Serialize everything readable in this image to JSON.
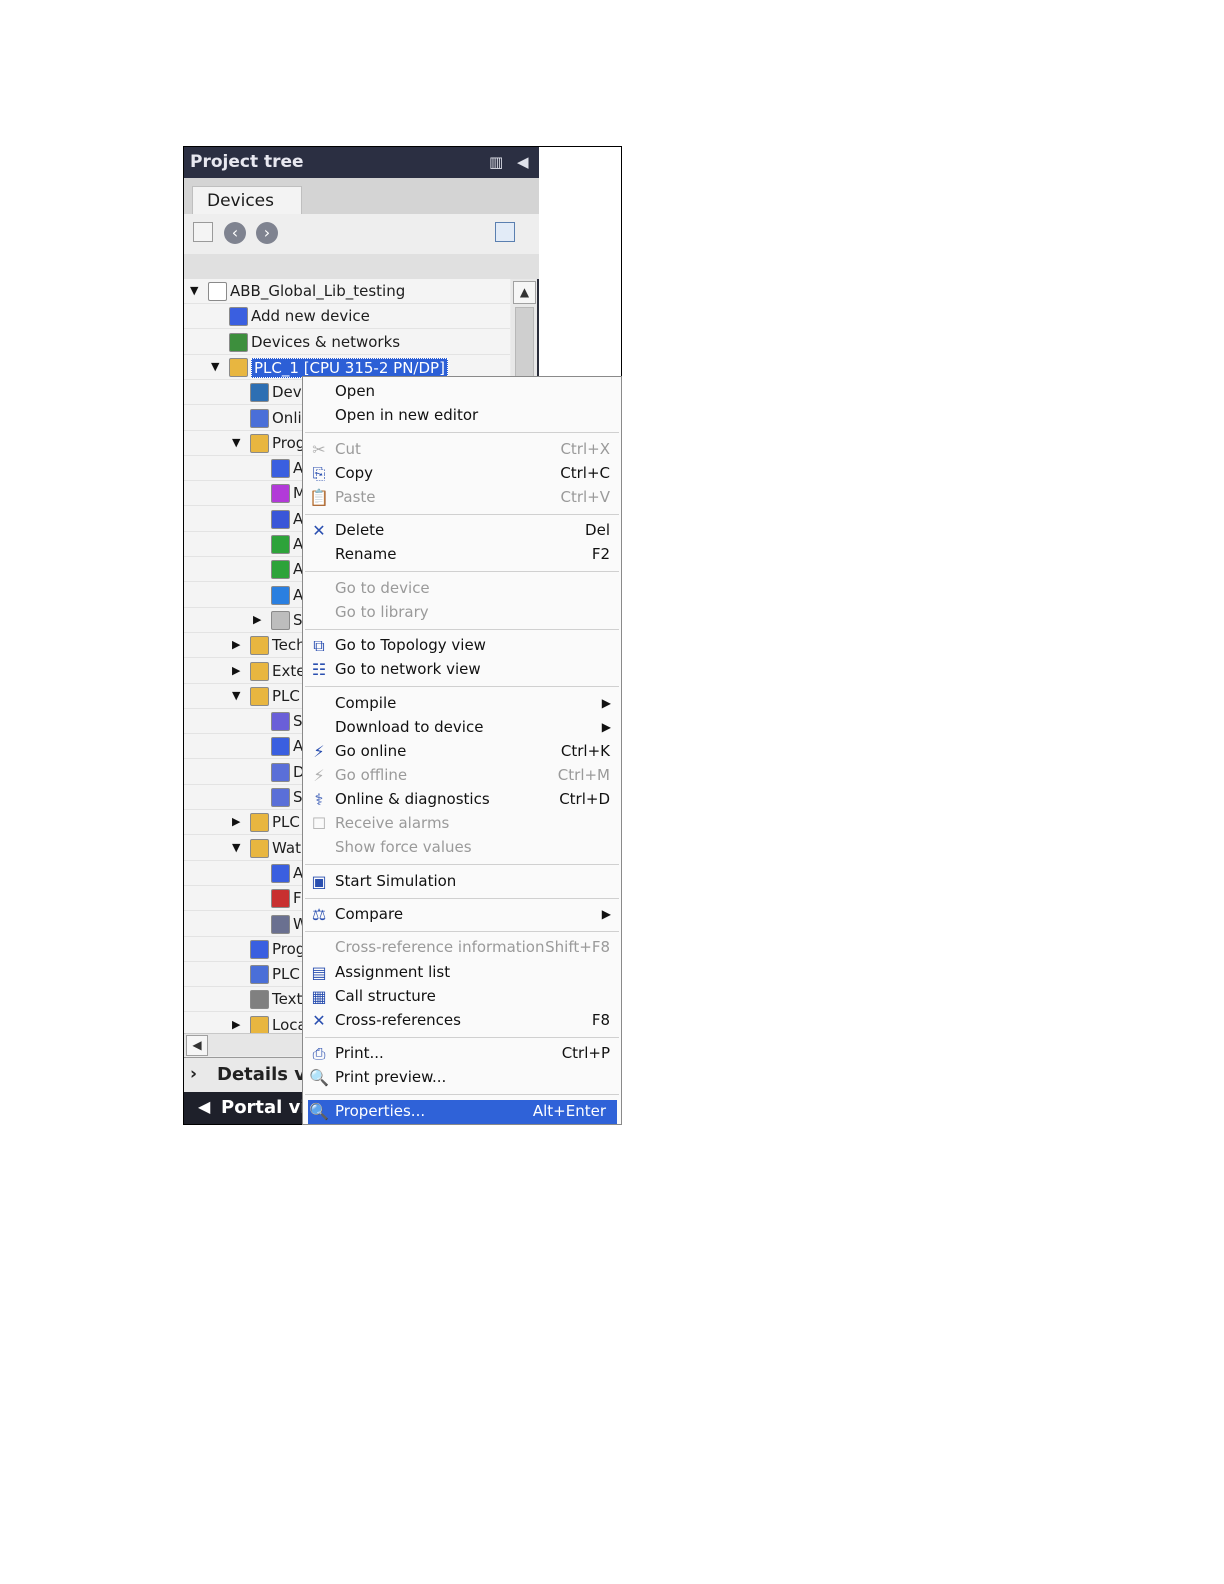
{
  "panel": {
    "title": "Project tree",
    "tab": "Devices",
    "details_label": "Details vi",
    "portal_label": "Portal vie"
  },
  "tree": [
    {
      "label": "ABB_Global_Lib_testing",
      "icon": "project-icon",
      "arrow": "▼",
      "color": "#ffffff"
    },
    {
      "label": "Add new device",
      "icon": "add-device-icon",
      "arrow": "",
      "color": "#3a5fe0"
    },
    {
      "label": "Devices & networks",
      "icon": "network-icon",
      "arrow": "",
      "color": "#3d8f3d"
    },
    {
      "label": "PLC_1 [CPU 315-2 PN/DP]",
      "icon": "plc-folder-icon",
      "arrow": "▼",
      "color": "#e8b640"
    },
    {
      "label": "Dev",
      "icon": "device-config-icon",
      "arrow": "",
      "color": "#2d6fb3"
    },
    {
      "label": "Onli",
      "icon": "online-diagnostics-icon",
      "arrow": "",
      "color": "#4a6fd8"
    },
    {
      "label": "Prog",
      "icon": "program-blocks-folder-icon",
      "arrow": "▼",
      "color": "#e8b640"
    },
    {
      "label": "A",
      "icon": "add-block-icon",
      "arrow": "",
      "color": "#3a5fe0"
    },
    {
      "label": "M",
      "icon": "main-block-icon",
      "arrow": "",
      "color": "#b23ad8"
    },
    {
      "label": "A",
      "icon": "data-block-icon",
      "arrow": "",
      "color": "#3a56d8"
    },
    {
      "label": "A",
      "icon": "function-block-icon",
      "arrow": "",
      "color": "#2da33a"
    },
    {
      "label": "A",
      "icon": "function-block-icon",
      "arrow": "",
      "color": "#2da33a"
    },
    {
      "label": "A",
      "icon": "function-icon",
      "arrow": "",
      "color": "#2a7fe0"
    },
    {
      "label": "S",
      "icon": "system-blocks-icon",
      "arrow": "▶",
      "color": "#bdbdbd"
    },
    {
      "label": "Tech",
      "icon": "technology-objects-icon",
      "arrow": "▶",
      "color": "#e8b640"
    },
    {
      "label": "Exte",
      "icon": "external-sources-icon",
      "arrow": "▶",
      "color": "#e8b640"
    },
    {
      "label": "PLC",
      "icon": "plc-tags-folder-icon",
      "arrow": "▼",
      "color": "#e8b640"
    },
    {
      "label": "S",
      "icon": "show-all-tags-icon",
      "arrow": "",
      "color": "#6a5fd8"
    },
    {
      "label": "A",
      "icon": "add-tag-table-icon",
      "arrow": "",
      "color": "#3a5fe0"
    },
    {
      "label": "D",
      "icon": "default-tag-table-icon",
      "arrow": "",
      "color": "#5a6fd8"
    },
    {
      "label": "S",
      "icon": "tag-table-icon",
      "arrow": "",
      "color": "#5a6fd8"
    },
    {
      "label": "PLC",
      "icon": "plc-data-types-icon",
      "arrow": "▶",
      "color": "#e8b640"
    },
    {
      "label": "Wat",
      "icon": "watch-tables-folder-icon",
      "arrow": "▼",
      "color": "#e8b640"
    },
    {
      "label": "A",
      "icon": "add-watch-table-icon",
      "arrow": "",
      "color": "#3a5fe0"
    },
    {
      "label": "F",
      "icon": "force-table-icon",
      "arrow": "",
      "color": "#c83030"
    },
    {
      "label": "W",
      "icon": "watch-table-icon",
      "arrow": "",
      "color": "#6a7090"
    },
    {
      "label": "Prog",
      "icon": "program-info-icon",
      "arrow": "",
      "color": "#3a5fe0"
    },
    {
      "label": "PLC",
      "icon": "plc-alarms-icon",
      "arrow": "",
      "color": "#4a6fd8"
    },
    {
      "label": "Text",
      "icon": "text-lists-icon",
      "arrow": "",
      "color": "#808080"
    },
    {
      "label": "Loca",
      "icon": "local-modules-folder-icon",
      "arrow": "▶",
      "color": "#e8b640"
    }
  ],
  "menu": [
    {
      "label": "Open",
      "shortcut": "",
      "icon": "",
      "glyph": "",
      "disabled": false,
      "submenu": false,
      "highlight": false
    },
    {
      "label": "Open in new editor",
      "shortcut": "",
      "icon": "",
      "glyph": "",
      "disabled": false,
      "submenu": false,
      "highlight": false,
      "sep_after": true
    },
    {
      "label": "Cut",
      "shortcut": "Ctrl+X",
      "icon": "scissors-icon",
      "glyph": "✂",
      "disabled": true,
      "submenu": false,
      "highlight": false
    },
    {
      "label": "Copy",
      "shortcut": "Ctrl+C",
      "icon": "copy-icon",
      "glyph": "⎘",
      "disabled": false,
      "submenu": false,
      "highlight": false
    },
    {
      "label": "Paste",
      "shortcut": "Ctrl+V",
      "icon": "paste-icon",
      "glyph": "📋",
      "disabled": true,
      "submenu": false,
      "highlight": false,
      "sep_after": true
    },
    {
      "label": "Delete",
      "shortcut": "Del",
      "icon": "delete-icon",
      "glyph": "✕",
      "disabled": false,
      "submenu": false,
      "highlight": false
    },
    {
      "label": "Rename",
      "shortcut": "F2",
      "icon": "",
      "glyph": "",
      "disabled": false,
      "submenu": false,
      "highlight": false,
      "sep_after": true
    },
    {
      "label": "Go to device",
      "shortcut": "",
      "icon": "",
      "glyph": "",
      "disabled": true,
      "submenu": false,
      "highlight": false
    },
    {
      "label": "Go to library",
      "shortcut": "",
      "icon": "",
      "glyph": "",
      "disabled": true,
      "submenu": false,
      "highlight": false,
      "sep_after": true
    },
    {
      "label": "Go to Topology view",
      "shortcut": "",
      "icon": "topology-icon",
      "glyph": "⧉",
      "disabled": false,
      "submenu": false,
      "highlight": false
    },
    {
      "label": "Go to network view",
      "shortcut": "",
      "icon": "network-view-icon",
      "glyph": "☷",
      "disabled": false,
      "submenu": false,
      "highlight": false,
      "sep_after": true
    },
    {
      "label": "Compile",
      "shortcut": "",
      "icon": "",
      "glyph": "",
      "disabled": false,
      "submenu": true,
      "highlight": false
    },
    {
      "label": "Download to device",
      "shortcut": "",
      "icon": "",
      "glyph": "",
      "disabled": false,
      "submenu": true,
      "highlight": false
    },
    {
      "label": "Go online",
      "shortcut": "Ctrl+K",
      "icon": "go-online-icon",
      "glyph": "⚡",
      "disabled": false,
      "submenu": false,
      "highlight": false
    },
    {
      "label": "Go offline",
      "shortcut": "Ctrl+M",
      "icon": "go-offline-icon",
      "glyph": "⚡",
      "disabled": true,
      "submenu": false,
      "highlight": false
    },
    {
      "label": "Online & diagnostics",
      "shortcut": "Ctrl+D",
      "icon": "online-diagnostics-icon",
      "glyph": "⚕",
      "disabled": false,
      "submenu": false,
      "highlight": false
    },
    {
      "label": "Receive alarms",
      "shortcut": "",
      "icon": "checkbox-icon",
      "glyph": "☐",
      "disabled": true,
      "submenu": false,
      "highlight": false
    },
    {
      "label": "Show force values",
      "shortcut": "",
      "icon": "",
      "glyph": "",
      "disabled": true,
      "submenu": false,
      "highlight": false,
      "sep_after": true
    },
    {
      "label": "Start Simulation",
      "shortcut": "",
      "icon": "simulation-icon",
      "glyph": "▣",
      "disabled": false,
      "submenu": false,
      "highlight": false,
      "sep_after": true
    },
    {
      "label": "Compare",
      "shortcut": "",
      "icon": "compare-icon",
      "glyph": "⚖",
      "disabled": false,
      "submenu": true,
      "highlight": false,
      "sep_after": true
    },
    {
      "label": "Cross-reference information",
      "shortcut": "Shift+F8",
      "icon": "",
      "glyph": "",
      "disabled": true,
      "submenu": false,
      "highlight": false
    },
    {
      "label": "Assignment list",
      "shortcut": "",
      "icon": "assignment-list-icon",
      "glyph": "▤",
      "disabled": false,
      "submenu": false,
      "highlight": false
    },
    {
      "label": "Call structure",
      "shortcut": "",
      "icon": "call-structure-icon",
      "glyph": "▦",
      "disabled": false,
      "submenu": false,
      "highlight": false
    },
    {
      "label": "Cross-references",
      "shortcut": "F8",
      "icon": "cross-references-icon",
      "glyph": "✕",
      "disabled": false,
      "submenu": false,
      "highlight": false,
      "sep_after": true
    },
    {
      "label": "Print...",
      "shortcut": "Ctrl+P",
      "icon": "print-icon",
      "glyph": "⎙",
      "disabled": false,
      "submenu": false,
      "highlight": false
    },
    {
      "label": "Print preview...",
      "shortcut": "",
      "icon": "print-preview-icon",
      "glyph": "🔍",
      "disabled": false,
      "submenu": false,
      "highlight": false,
      "sep_after": true
    },
    {
      "label": "Properties...",
      "shortcut": "Alt+Enter",
      "icon": "properties-icon",
      "glyph": "🔍",
      "disabled": false,
      "submenu": false,
      "highlight": true
    }
  ]
}
